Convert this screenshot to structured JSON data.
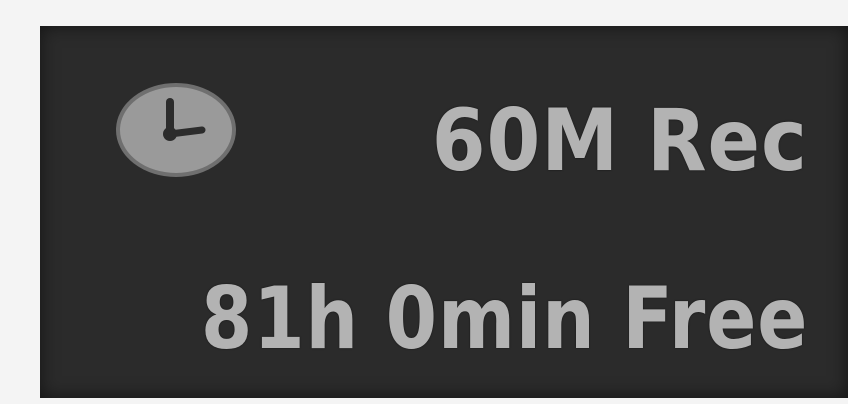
{
  "osd": {
    "icon": "clock-icon",
    "record_mode": "60M Rec",
    "free_space": "81h 0min Free",
    "colors": {
      "panel": "#2b2b2b",
      "text": "#b3b3b3",
      "background": "#f4f4f4"
    }
  }
}
